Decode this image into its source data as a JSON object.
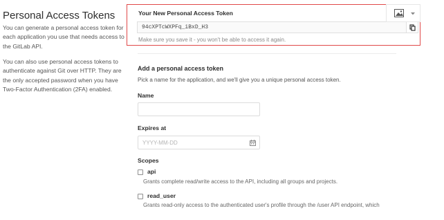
{
  "sidebar": {
    "title": "Personal Access Tokens",
    "paragraph1": "You can generate a personal access token for each application you use that needs access to the GitLab API.",
    "paragraph2": "You can also use personal access tokens to authenticate against Git over HTTP. They are the only accepted password when you have Two-Factor Authentication (2FA) enabled."
  },
  "new_token": {
    "label": "Your New Personal Access Token",
    "value": "94cXPTcWXPFq_iBxD_H3",
    "help": "Make sure you save it - you won't be able to access it again.",
    "copy_icon": "clipboard-icon"
  },
  "toolbar": {
    "image_icon": "image-icon",
    "dropdown_icon": "chevron-down-icon"
  },
  "form": {
    "title": "Add a personal access token",
    "description": "Pick a name for the application, and we'll give you a unique personal access token.",
    "name_label": "Name",
    "name_value": "",
    "expires_label": "Expires at",
    "expires_placeholder": "YYYY-MM-DD",
    "calendar_icon": "calendar-icon",
    "scopes_label": "Scopes",
    "scopes": [
      {
        "name": "api",
        "description": "Grants complete read/write access to the API, including all groups and projects.",
        "checked": false
      },
      {
        "name": "read_user",
        "description": "Grants read-only access to the authenticated user's profile through the /user API endpoint, which",
        "checked": false
      }
    ]
  },
  "colors": {
    "highlight_border": "#e04848",
    "text": "#2e2e2e",
    "muted": "#8a8a8a"
  }
}
